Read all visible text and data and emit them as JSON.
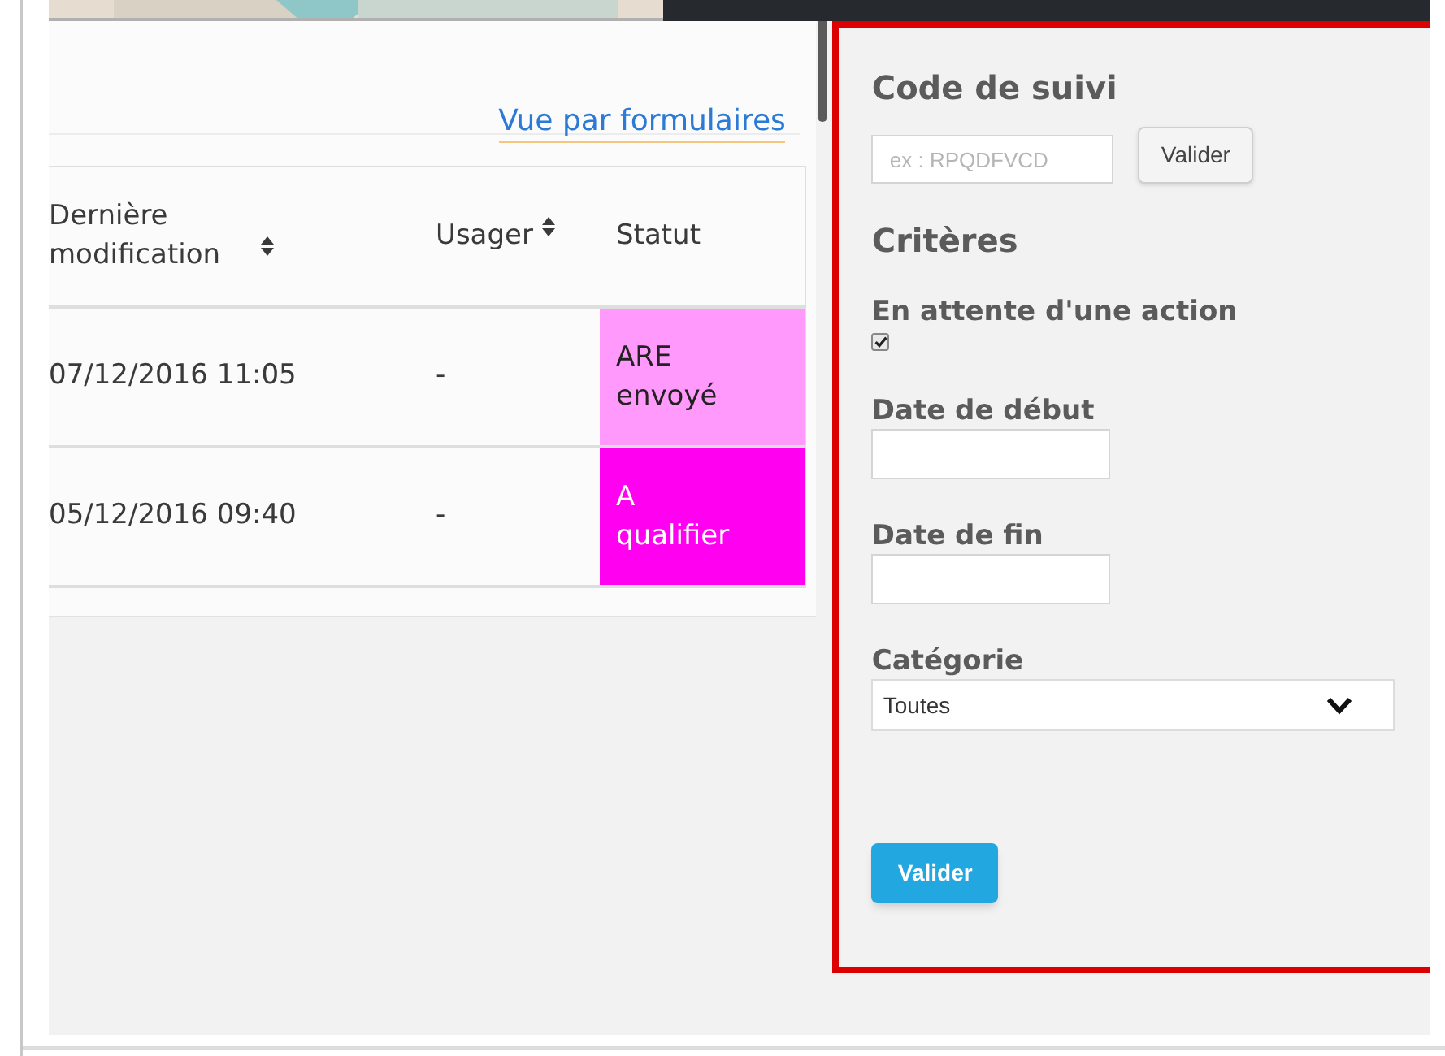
{
  "view_link": "Vue par formulaires",
  "table": {
    "columns": [
      {
        "label": "Dernière modification",
        "sortable": true
      },
      {
        "label": "Usager",
        "sortable": true
      },
      {
        "label": "Statut",
        "sortable": false
      }
    ],
    "rows": [
      {
        "modified": "07/12/2016 11:05",
        "user": "-",
        "status": "ARE envoyé",
        "color": "#ff99fb"
      },
      {
        "modified": "05/12/2016 09:40",
        "user": "-",
        "status": "A qualifier",
        "color": "#ff00f0"
      }
    ]
  },
  "filters": {
    "tracking_title": "Code de suivi",
    "tracking_placeholder": "ex : RPQDFVCD",
    "tracking_button": "Valider",
    "criteria_title": "Critères",
    "pending_label": "En attente d'une action",
    "pending_checked": true,
    "start_label": "Date de début",
    "end_label": "Date de fin",
    "category_label": "Catégorie",
    "category_value": "Toutes",
    "submit": "Valider"
  }
}
